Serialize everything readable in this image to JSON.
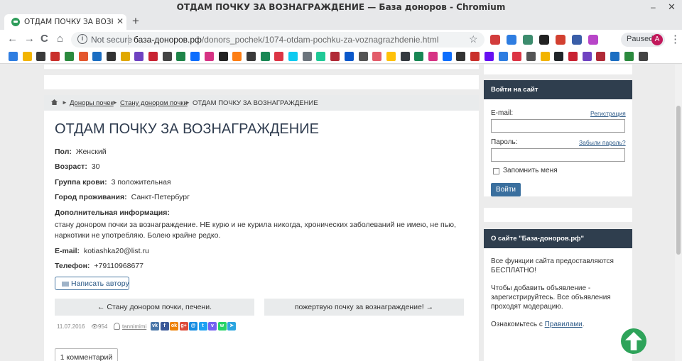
{
  "window": {
    "title": "ОТДАМ ПОЧКУ ЗА ВОЗНАГРАЖДЕНИЕ — База доноров - Chromium",
    "minimize": "–",
    "close": "✕"
  },
  "tab": {
    "label": "ОТДАМ ПОЧКУ ЗА ВОЗНАГРАЖДЕНИЕ",
    "close": "✕",
    "new_tab": "+"
  },
  "toolbar": {
    "back": "←",
    "forward": "→",
    "reload": "C",
    "home": "⌂",
    "security_label": "Not secure",
    "url_host": "база-доноров.рф",
    "url_path": "/donors_pochek/1074-otdam-pochku-za-voznagrazhdenie.html",
    "star": "☆",
    "profile_status": "Paused",
    "profile_initial": "A",
    "menu": "⋮"
  },
  "extension_colors": [
    "#d23c3c",
    "#2e7de1",
    "#3d8c6e",
    "#222222",
    "#d24030",
    "#3a5ea8",
    "#b845c8"
  ],
  "bookmark_colors": [
    "#2e7de1",
    "#f2b400",
    "#3a3a3a",
    "#c9302c",
    "#2b8a3e",
    "#e4572e",
    "#1b6ec2",
    "#333333",
    "#e0a800",
    "#6f42c1",
    "#c82333",
    "#444444",
    "#1e8449",
    "#0d6efd",
    "#d63384",
    "#222222",
    "#fd7e14",
    "#3a3a3a",
    "#198754",
    "#dc3545",
    "#0dcaf0",
    "#6c757d",
    "#20c997",
    "#b02a37",
    "#0a58ca",
    "#555555",
    "#e35d6a",
    "#ffc107",
    "#343a40",
    "#198754",
    "#d63384",
    "#0d6efd",
    "#333333",
    "#c9302c",
    "#6610f2",
    "#2e7de1",
    "#dc3545",
    "#555555",
    "#f2b400",
    "#212529",
    "#c82333",
    "#6f42c1",
    "#b02a37",
    "#1b6ec2",
    "#2b8a3e",
    "#444444"
  ],
  "breadcrumb": {
    "item1": "Доноры почек",
    "item2": "Стану донором почки",
    "current": "ОТДАМ ПОЧКУ ЗА ВОЗНАГРАЖДЕНИЕ",
    "sep": "►"
  },
  "ad": {
    "title": "ОТДАМ ПОЧКУ ЗА ВОЗНАГРАЖДЕНИЕ",
    "gender_label": "Пол:",
    "gender": "Женский",
    "age_label": "Возраст:",
    "age": "30",
    "blood_label": "Группа крови:",
    "blood": "3 положительная",
    "city_label": "Город проживания:",
    "city": "Санкт-Петербург",
    "info_label": "Дополнительная информация:",
    "info": "стану донором почки за вознаграждение. НЕ курю и не курила никогда, хронических заболеваний не имею, не пью, наркотики не употребляю. Болею крайне редко.",
    "email_label": "E-mail:",
    "email": "kotiashka20@list.ru",
    "phone_label": "Телефон:",
    "phone": "+79110968677",
    "write_button": "Написать автору"
  },
  "navigation": {
    "prev": "← Стану донором почки, печени.",
    "next": "пожертвую почку за вознаграждение! →"
  },
  "meta": {
    "date": "11.07.2016",
    "eye_icon": "👁",
    "views": "954",
    "author": "tannimimi"
  },
  "share_buttons": [
    {
      "name": "vk",
      "glyph": "vk",
      "color": "#4a76a8"
    },
    {
      "name": "facebook",
      "glyph": "f",
      "color": "#3b5998"
    },
    {
      "name": "odnoklassniki",
      "glyph": "ok",
      "color": "#ee8208"
    },
    {
      "name": "google-plus",
      "glyph": "g+",
      "color": "#dd4b39"
    },
    {
      "name": "moimir",
      "glyph": "@",
      "color": "#168de2"
    },
    {
      "name": "twitter",
      "glyph": "t",
      "color": "#1da1f2"
    },
    {
      "name": "viber",
      "glyph": "v",
      "color": "#7360f2"
    },
    {
      "name": "whatsapp",
      "glyph": "w",
      "color": "#25d366"
    },
    {
      "name": "telegram",
      "glyph": "➤",
      "color": "#2ca5e0"
    }
  ],
  "comments_button": "1 комментарий",
  "sidebar": {
    "top_text": "…",
    "login": {
      "header": "Войти на сайт",
      "email_label": "E-mail:",
      "register_link": "Регистрация",
      "password_label": "Пароль:",
      "forgot_link": "Забыли пароль?",
      "remember": "Запомнить меня",
      "submit": "Войти"
    },
    "about": {
      "header": "О сайте \"База-доноров.рф\"",
      "p1": "Все функции сайта предоставляются БЕСПЛАТНО!",
      "p2": "Чтобы добавить объявление - зарегистрируйтесь. Все объявления проходят модерацию.",
      "p3_prefix": "Ознакомьтесь с ",
      "p3_link": "Правилами",
      "p3_suffix": "."
    }
  },
  "colors": {
    "panel_header": "#2f3e4e",
    "accent_link": "#2d5a87",
    "scroll_to_top": "#2ea35a"
  }
}
